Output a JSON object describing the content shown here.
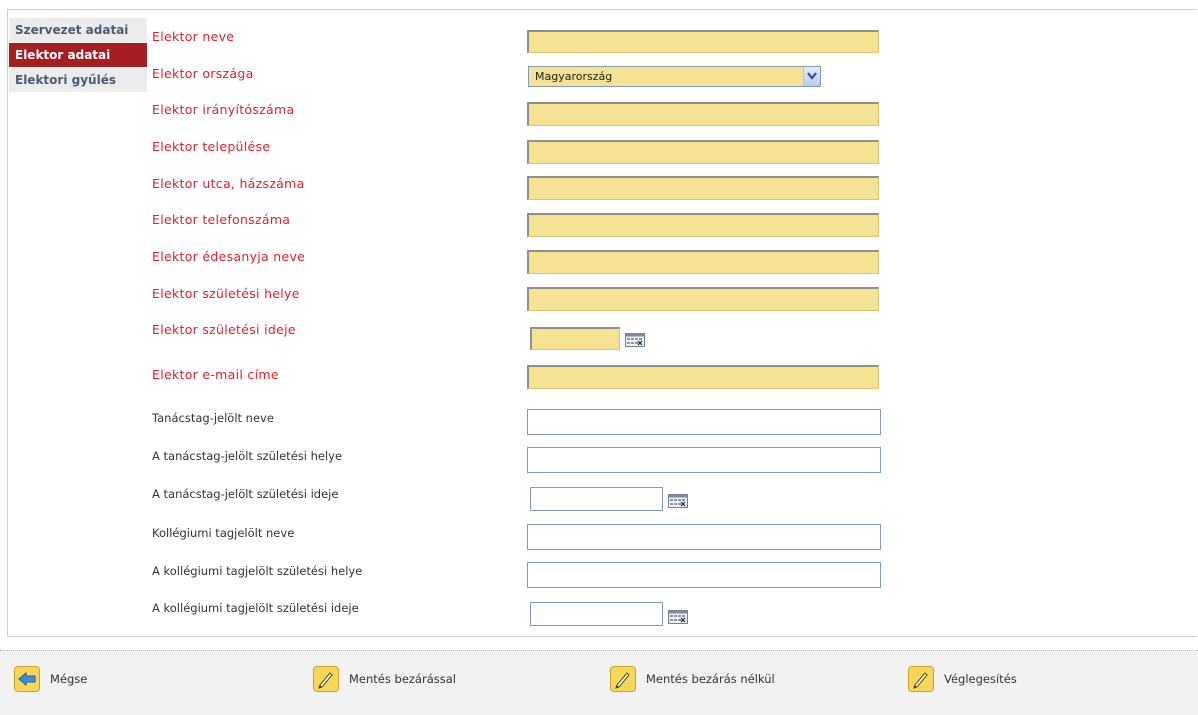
{
  "tabs": [
    {
      "label": "Szervezet adatai",
      "active": false
    },
    {
      "label": "Elektor adatai",
      "active": true
    },
    {
      "label": "Elektori gyűlés",
      "active": false
    }
  ],
  "fields": {
    "elektor_neve": {
      "label": "Elektor neve",
      "value": ""
    },
    "elektor_orszaga": {
      "label": "Elektor országa",
      "value": "Magyarország"
    },
    "elektor_iranyitoszama": {
      "label": "Elektor irányítószáma",
      "value": ""
    },
    "elektor_telepulese": {
      "label": "Elektor települése",
      "value": ""
    },
    "elektor_utca": {
      "label": "Elektor utca, házszáma",
      "value": ""
    },
    "elektor_telefonszama": {
      "label": "Elektor telefonszáma",
      "value": ""
    },
    "elektor_edesanyja": {
      "label": "Elektor édesanyja neve",
      "value": ""
    },
    "elektor_szul_helye": {
      "label": "Elektor születési helye",
      "value": ""
    },
    "elektor_szul_ideje": {
      "label": "Elektor születési ideje",
      "value": ""
    },
    "elektor_email": {
      "label": "Elektor e-mail címe",
      "value": ""
    },
    "tanacstag_neve": {
      "label": "Tanácstag-jelölt neve",
      "value": ""
    },
    "tanacstag_szul_helye": {
      "label": "A tanácstag-jelölt születési helye",
      "value": ""
    },
    "tanacstag_szul_ideje": {
      "label": "A tanácstag-jelölt születési ideje",
      "value": ""
    },
    "kollegiumi_neve": {
      "label": "Kollégiumi tagjelölt neve",
      "value": ""
    },
    "kollegiumi_szul_helye": {
      "label": "A kollégiumi tagjelölt születési helye",
      "value": ""
    },
    "kollegiumi_szul_ideje": {
      "label": "A kollégiumi tagjelölt születési ideje",
      "value": ""
    }
  },
  "buttons": {
    "cancel": "Mégse",
    "save_close": "Mentés bezárással",
    "save_no_close": "Mentés bezárás nélkül",
    "finalize": "Véglegesítés"
  },
  "colors": {
    "required_label": "#e3202a",
    "active_tab": "#a51e22",
    "required_field": "#f5e293"
  },
  "icons": {
    "calendar": "calendar-icon",
    "cancel": "back-arrow-icon",
    "save": "pencil-icon",
    "dropdown": "chevron-down-icon"
  }
}
